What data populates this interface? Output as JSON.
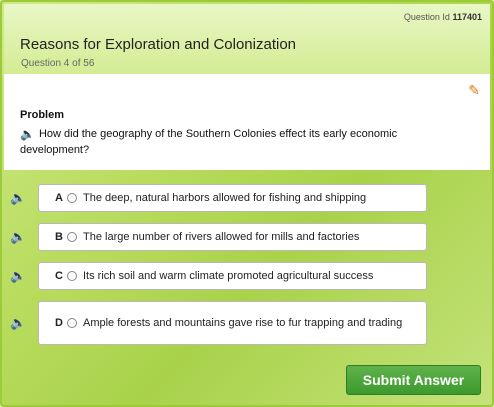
{
  "header": {
    "question_id_label": "Question Id",
    "question_id_value": "117401",
    "title": "Reasons for Exploration and Colonization",
    "progress": "Question 4 of 56"
  },
  "problem": {
    "label": "Problem",
    "text": "How did the geography of the Southern Colonies effect its early economic development?"
  },
  "choices": [
    {
      "letter": "A",
      "text": "The deep, natural harbors allowed for fishing and shipping"
    },
    {
      "letter": "B",
      "text": "The large number of rivers allowed for mills and factories"
    },
    {
      "letter": "C",
      "text": "Its rich soil and warm climate promoted agricultural success"
    },
    {
      "letter": "D",
      "text": "Ample forests and mountains gave rise to fur trapping and trading"
    }
  ],
  "submit_label": "Submit Answer",
  "icons": {
    "speaker": "speaker-icon",
    "pencil": "pencil-icon"
  },
  "colors": {
    "accent_green": "#3d9a2f",
    "frame_green": "#b9dc5e"
  }
}
